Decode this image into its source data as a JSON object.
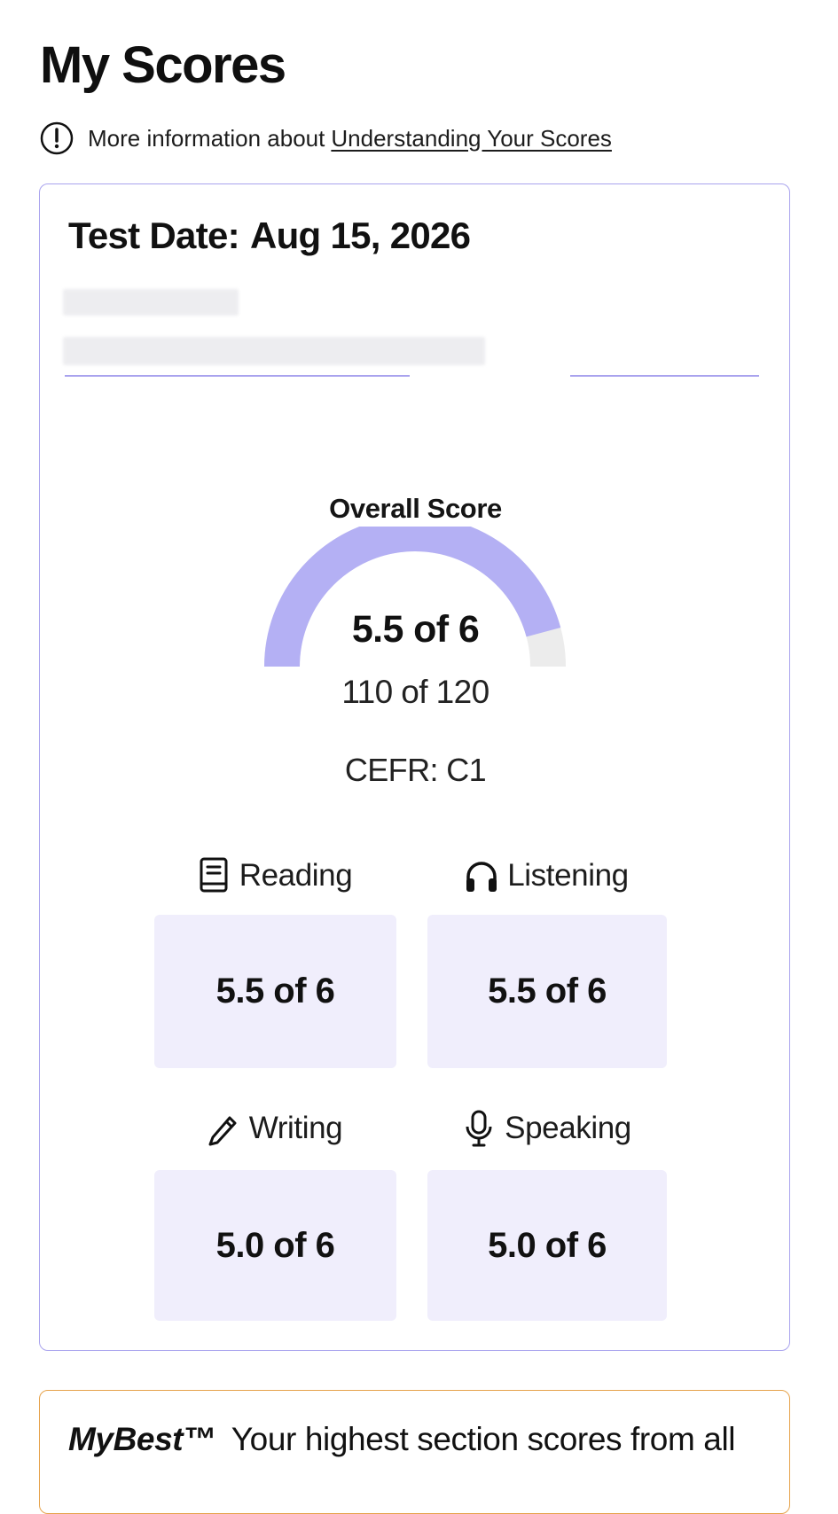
{
  "page": {
    "title": "My Scores"
  },
  "info": {
    "icon": "exclamation-circle-icon",
    "prefix": "More information about",
    "link_label": "Understanding Your Scores"
  },
  "score_card": {
    "test_date_label": "Test Date:",
    "test_date_value": "Aug 15, 2026",
    "accent_color": "#a9a3ee",
    "overall": {
      "label": "Overall Score",
      "main": "5.5 of 6",
      "sub": "110 of 120",
      "cefr": "CEFR: C1",
      "gauge_fraction": 0.9167,
      "gauge_fill_color": "#b4b0f4",
      "gauge_track_color": "#ececec"
    },
    "sections": [
      {
        "name": "reading",
        "label": "Reading",
        "score": "5.5 of 6",
        "icon": "book-icon"
      },
      {
        "name": "listening",
        "label": "Listening",
        "score": "5.5 of 6",
        "icon": "headphones-icon"
      },
      {
        "name": "writing",
        "label": "Writing",
        "score": "5.0 of 6",
        "icon": "pencil-icon"
      },
      {
        "name": "speaking",
        "label": "Speaking",
        "score": "5.0 of 6",
        "icon": "microphone-icon"
      }
    ],
    "score_box_color": "#f0eefc"
  },
  "mybest": {
    "brand": "MyBest™",
    "text": "Your highest section scores from all",
    "border_color": "#e6a24a"
  }
}
